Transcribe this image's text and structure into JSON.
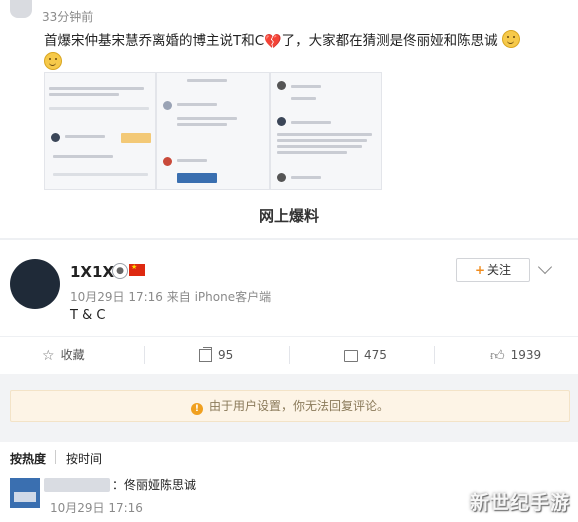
{
  "repost": {
    "time": "33分钟前",
    "text_part1": "首爆宋仲基宋慧乔离婚的博主说T和C",
    "text_part2": "了，大家都在猜测是佟丽娅和陈思诚"
  },
  "collage": {
    "caption": "网上爆料"
  },
  "post": {
    "username": "1X1X",
    "meta": "10月29日 17:16 来自 iPhone客户端",
    "text": "T & C",
    "follow_label": "关注",
    "follow_plus": "+"
  },
  "actions": {
    "favorite_label": "收藏",
    "repost_count": "95",
    "comment_count": "475",
    "like_count": "1939"
  },
  "notice": {
    "text": "由于用户设置，你无法回复评论。",
    "icon_glyph": "!"
  },
  "sort": {
    "hot_label": "按热度",
    "time_label": "按时间"
  },
  "comment": {
    "text": "：佟丽娅陈思诚",
    "time": "10月29日 17:16"
  },
  "watermark": "新世纪手游",
  "colors": {
    "follow_plus": "#f08c1e",
    "notice_bg": "#fdf4e6",
    "notice_icon": "#f0a020"
  }
}
